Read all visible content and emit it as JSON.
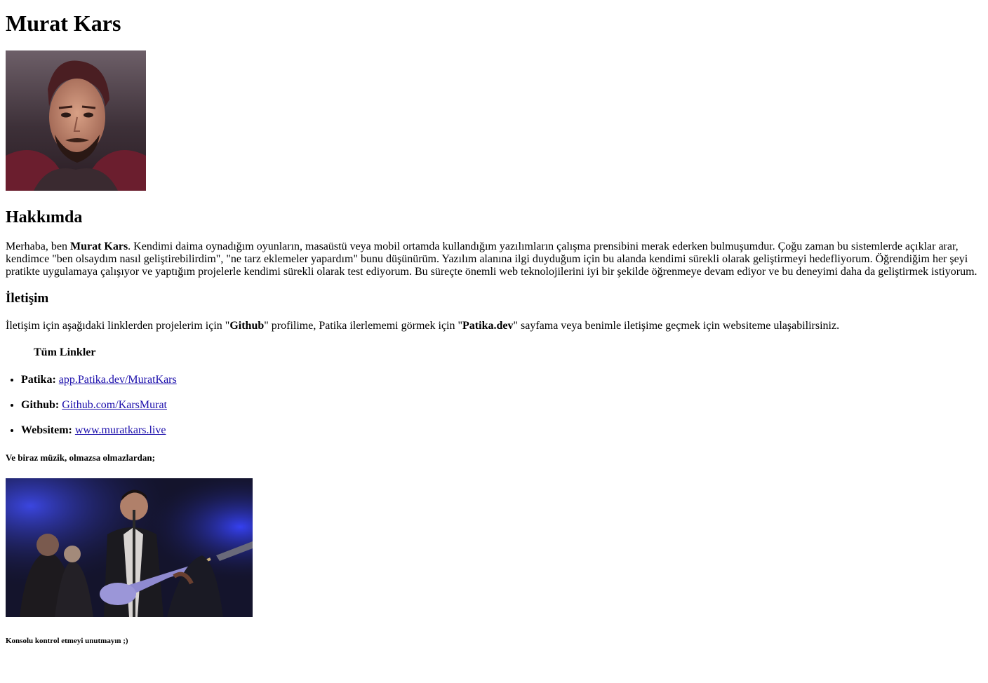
{
  "header": {
    "name": "Murat Kars"
  },
  "about": {
    "heading": "Hakkımda",
    "intro_prefix": "Merhaba, ben ",
    "intro_name": "Murat Kars",
    "intro_rest": ". Kendimi daima oynadığım oyunların, masaüstü veya mobil ortamda kullandığım yazılımların çalışma prensibini merak ederken bulmuşumdur. Çoğu zaman bu sistemlerde açıklar arar, kendimce \"ben olsaydım nasıl geliştirebilirdim\", \"ne tarz eklemeler yapardım\" bunu düşünürüm. Yazılım alanına ilgi duyduğum için bu alanda kendimi sürekli olarak geliştirmeyi hedefliyorum. Öğrendiğim her şeyi pratikte uygulamaya çalışıyor ve yaptığım projelerle kendimi sürekli olarak test ediyorum. Bu süreçte önemli web teknolojilerini iyi bir şekilde öğrenmeye devam ediyor ve bu deneyimi daha da geliştirmek istiyorum."
  },
  "contact": {
    "heading": "İletişim",
    "text_1": "İletişim için aşağıdaki linklerden projelerim için \"",
    "github_bold": "Github",
    "text_2": "\" profilime, Patika ilerlememi görmek için \"",
    "patika_bold": "Patika.dev",
    "text_3": "\" sayfama veya benimle iletişime geçmek için websiteme ulaşabilirsiniz.",
    "links_heading": "Tüm Linkler",
    "links": [
      {
        "label": "Patika:",
        "text": "app.Patika.dev/MuratKars"
      },
      {
        "label": "Github:",
        "text": "Github.com/KarsMurat"
      },
      {
        "label": "Websitem:",
        "text": "www.muratkars.live"
      }
    ]
  },
  "music": {
    "heading": "Ve biraz müzik, olmazsa olmazlardan;"
  },
  "footer": {
    "note": "Konsolu kontrol etmeyi unutmayın ;)"
  },
  "images": {
    "portrait": "portrait-avatar",
    "concert": "concert-video-thumbnail"
  }
}
